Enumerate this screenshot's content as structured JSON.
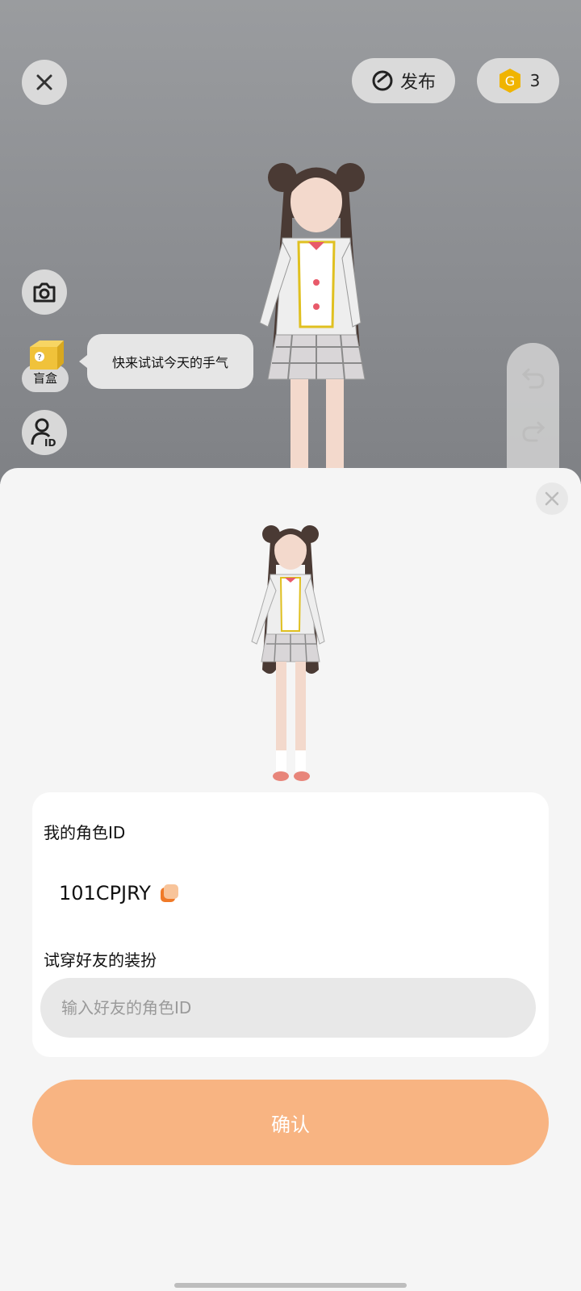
{
  "header": {
    "publish_label": "发布",
    "coin_count": "3"
  },
  "left_tools": {
    "blindbox_label": "盲盒",
    "tip_text": "快来试试今天的手气"
  },
  "sheet": {
    "my_id_label": "我的角色ID",
    "my_id_value": "101CPJRY",
    "try_friend_label": "试穿好友的装扮",
    "friend_id_placeholder": "输入好友的角色ID",
    "confirm_label": "确认"
  },
  "colors": {
    "accent": "#f8b482",
    "coin": "#f0b400"
  },
  "icons": [
    "close-icon",
    "publish-icon",
    "coin-icon",
    "camera-icon",
    "blindbox-icon",
    "id-icon",
    "undo-icon",
    "redo-icon",
    "copy-icon"
  ]
}
